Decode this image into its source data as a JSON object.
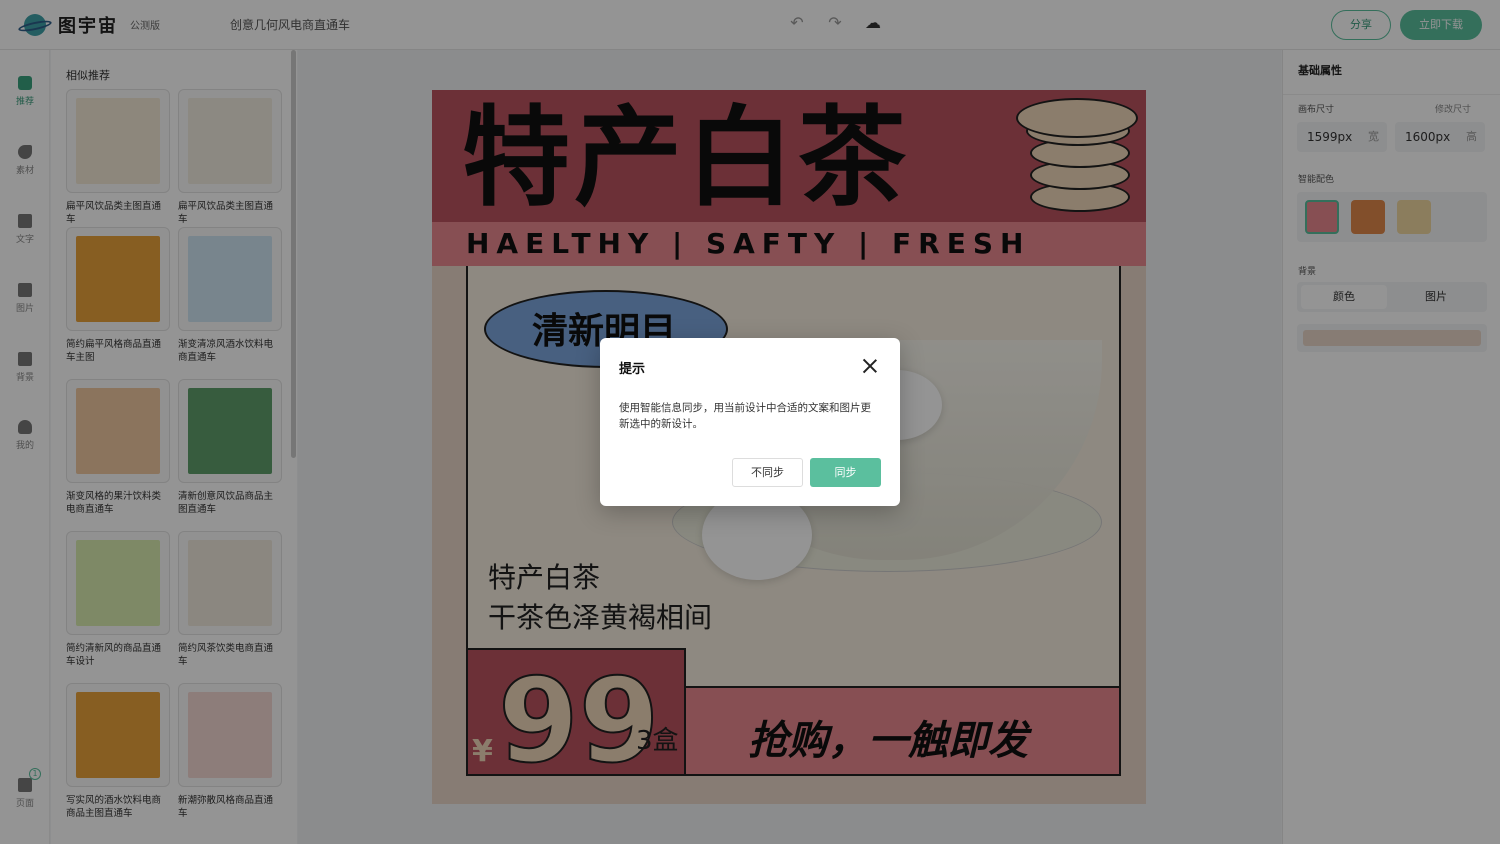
{
  "app": {
    "logo_text": "图宇宙",
    "beta_label": "公测版",
    "document_title": "创意几何风电商直通车",
    "share_label": "分享",
    "download_label": "立即下载"
  },
  "rail": {
    "items": [
      {
        "label": "推荐"
      },
      {
        "label": "素材"
      },
      {
        "label": "文字"
      },
      {
        "label": "图片"
      },
      {
        "label": "背景"
      },
      {
        "label": "我的"
      },
      {
        "label": "页面",
        "badge": "1"
      }
    ]
  },
  "panel": {
    "title": "相似推荐",
    "templates": [
      {
        "label": "扁平风饮品类主图直通车",
        "thumb_color": "#f3e9d6"
      },
      {
        "label": "扁平风饮品类主图直通车",
        "thumb_color": "#f2ece0"
      },
      {
        "label": "简约扁平风格商品直通车主图",
        "thumb_color": "#e8a33c"
      },
      {
        "label": "渐变清凉风酒水饮料电商直通车",
        "thumb_color": "#cfe6f3"
      },
      {
        "label": "渐变风格的果汁饮料类电商直通车",
        "thumb_color": "#f0c8a0"
      },
      {
        "label": "清新创意风饮品商品主图直通车",
        "thumb_color": "#5f9f6c"
      },
      {
        "label": "简约清新风的商品直通车设计",
        "thumb_color": "#d9ecb0"
      },
      {
        "label": "简约风茶饮类电商直通车",
        "thumb_color": "#efe9dc"
      },
      {
        "label": "写实风的酒水饮料电商商品主图直通车",
        "thumb_color": "#e8a33c"
      },
      {
        "label": "新潮弥散风格商品直通车",
        "thumb_color": "#f3d8d2"
      }
    ]
  },
  "design": {
    "title": "特产白茶",
    "tagline": "HAELTHY | SAFTY | FRESH",
    "badge": "清新明目",
    "desc_line1": "特产白茶",
    "desc_line2": "干茶色泽黄褐相间",
    "price_symbol": "¥",
    "price": "99",
    "price_unit": "3盒",
    "cta": "抢购，一触即发"
  },
  "props": {
    "heading": "基础属性",
    "canvas_size_label": "画布尺寸",
    "resize_link": "修改尺寸",
    "width_value": "1599px",
    "width_unit": "宽",
    "height_value": "1600px",
    "height_unit": "高",
    "smart_color_label": "智能配色",
    "palette": [
      "#e8888f",
      "#e0894a",
      "#f0d8a0"
    ],
    "background_label": "背景",
    "bg_tabs": [
      "颜色",
      "图片"
    ],
    "bg_color": "#e8d6c8"
  },
  "dialog": {
    "title": "提示",
    "body": "使用智能信息同步，用当前设计中合适的文案和图片更新选中的新设计。",
    "cancel_label": "不同步",
    "confirm_label": "同步"
  }
}
